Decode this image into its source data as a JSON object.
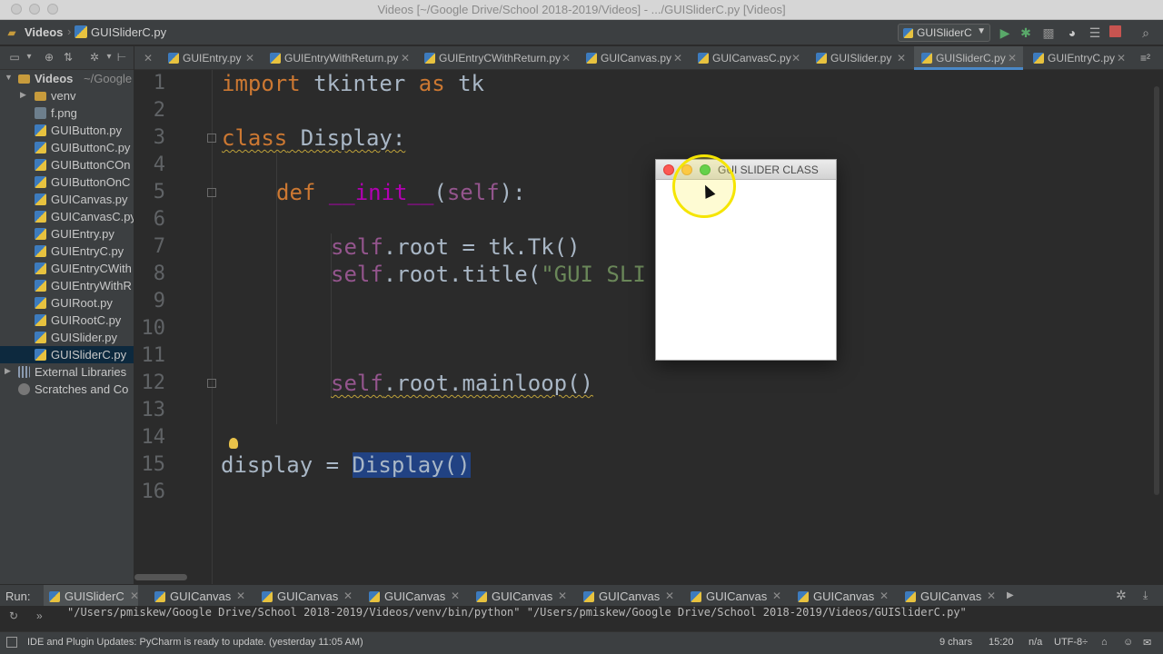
{
  "window": {
    "title": "Videos [~/Google Drive/School 2018-2019/Videos] - .../GUISliderC.py [Videos]"
  },
  "navbar": {
    "project": "Videos",
    "file": "GUISliderC.py",
    "run_config": "GUISliderC"
  },
  "tabs": [
    {
      "label": "GUIEntry.py"
    },
    {
      "label": "GUIEntryWithReturn.py"
    },
    {
      "label": "GUIEntryCWithReturn.py"
    },
    {
      "label": "GUICanvas.py"
    },
    {
      "label": "GUICanvasC.py"
    },
    {
      "label": "GUISlider.py"
    },
    {
      "label": "GUISliderC.py",
      "active": true
    },
    {
      "label": "GUIEntryC.py"
    }
  ],
  "tabs_overflow": "≡²",
  "project_tree": {
    "root_name": "Videos",
    "root_path": "~/Google",
    "items": [
      {
        "label": "venv",
        "kind": "folder"
      },
      {
        "label": "f.png",
        "kind": "png"
      },
      {
        "label": "GUIButton.py",
        "kind": "py"
      },
      {
        "label": "GUIButtonC.py",
        "kind": "py"
      },
      {
        "label": "GUIButtonCOn",
        "kind": "py"
      },
      {
        "label": "GUIButtonOnC",
        "kind": "py"
      },
      {
        "label": "GUICanvas.py",
        "kind": "py"
      },
      {
        "label": "GUICanvasC.py",
        "kind": "py"
      },
      {
        "label": "GUIEntry.py",
        "kind": "py"
      },
      {
        "label": "GUIEntryC.py",
        "kind": "py"
      },
      {
        "label": "GUIEntryCWith",
        "kind": "py"
      },
      {
        "label": "GUIEntryWithR",
        "kind": "py"
      },
      {
        "label": "GUIRoot.py",
        "kind": "py"
      },
      {
        "label": "GUIRootC.py",
        "kind": "py"
      },
      {
        "label": "GUISlider.py",
        "kind": "py"
      },
      {
        "label": "GUISliderC.py",
        "kind": "py",
        "selected": true
      }
    ],
    "external_libraries": "External Libraries",
    "scratches": "Scratches and Co"
  },
  "editor": {
    "line_numbers": [
      "1",
      "2",
      "3",
      "4",
      "5",
      "6",
      "7",
      "8",
      "9",
      "10",
      "11",
      "12",
      "13",
      "14",
      "15",
      "16"
    ],
    "code": {
      "l1_kw": "import",
      "l1_mod": " tkinter ",
      "l1_as": "as",
      "l1_alias": " tk",
      "l3_kw": "class",
      "l3_rest": " Display:",
      "l5_kw": "def",
      "l5_fn": "__init__",
      "l5_open": "(",
      "l5_self": "self",
      "l5_close": "):",
      "l7_self": "self",
      "l7_rest": ".root = tk.Tk()",
      "l8_self": "self",
      "l8_rest": ".root.title(",
      "l8_str": "\"GUI SLI",
      "l12_self": "self",
      "l12_rest": ".root.mainloop()",
      "l15_pre": "display = ",
      "l15_hl": "Display()"
    }
  },
  "tk_window": {
    "title": "GUI SLIDER CLASS"
  },
  "run_panel": {
    "label": "Run:",
    "tabs": [
      "GUISliderC",
      "GUICanvas",
      "GUICanvas",
      "GUICanvas",
      "GUICanvas",
      "GUICanvas",
      "GUICanvas",
      "GUICanvas",
      "GUICanvas"
    ],
    "command": "\"/Users/pmiskew/Google Drive/School 2018-2019/Videos/venv/bin/python\" \"/Users/pmiskew/Google Drive/School 2018-2019/Videos/GUISliderC.py\""
  },
  "status": {
    "message": "IDE and Plugin Updates: PyCharm is ready to update. (yesterday 11:05 AM)",
    "chars": "9 chars",
    "position": "15:20",
    "line_sep": "n/a",
    "encoding": "UTF-8÷"
  },
  "colors": {
    "ide_bg": "#2b2b2b",
    "panel_bg": "#3c3f41",
    "keyword": "#cc7832",
    "string": "#6a8759",
    "self": "#94558d",
    "accent": "#4a88c7",
    "run_green": "#59a869",
    "stop_red": "#c75450"
  }
}
